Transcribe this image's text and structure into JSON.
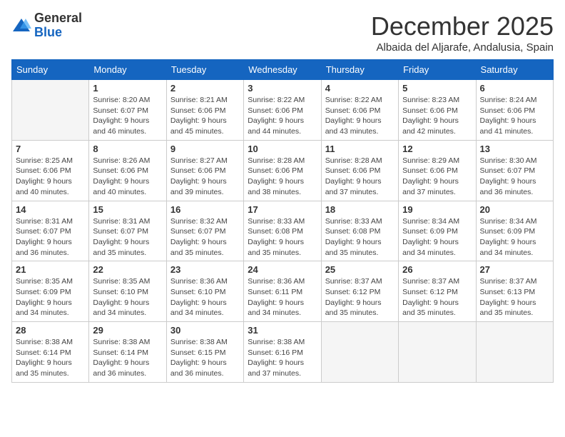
{
  "logo": {
    "general": "General",
    "blue": "Blue"
  },
  "title": "December 2025",
  "subtitle": "Albaida del Aljarafe, Andalusia, Spain",
  "days_of_week": [
    "Sunday",
    "Monday",
    "Tuesday",
    "Wednesday",
    "Thursday",
    "Friday",
    "Saturday"
  ],
  "weeks": [
    [
      {
        "day": "",
        "sunrise": "",
        "sunset": "",
        "daylight": "",
        "empty": true
      },
      {
        "day": "1",
        "sunrise": "Sunrise: 8:20 AM",
        "sunset": "Sunset: 6:07 PM",
        "daylight": "Daylight: 9 hours and 46 minutes."
      },
      {
        "day": "2",
        "sunrise": "Sunrise: 8:21 AM",
        "sunset": "Sunset: 6:06 PM",
        "daylight": "Daylight: 9 hours and 45 minutes."
      },
      {
        "day": "3",
        "sunrise": "Sunrise: 8:22 AM",
        "sunset": "Sunset: 6:06 PM",
        "daylight": "Daylight: 9 hours and 44 minutes."
      },
      {
        "day": "4",
        "sunrise": "Sunrise: 8:22 AM",
        "sunset": "Sunset: 6:06 PM",
        "daylight": "Daylight: 9 hours and 43 minutes."
      },
      {
        "day": "5",
        "sunrise": "Sunrise: 8:23 AM",
        "sunset": "Sunset: 6:06 PM",
        "daylight": "Daylight: 9 hours and 42 minutes."
      },
      {
        "day": "6",
        "sunrise": "Sunrise: 8:24 AM",
        "sunset": "Sunset: 6:06 PM",
        "daylight": "Daylight: 9 hours and 41 minutes."
      }
    ],
    [
      {
        "day": "7",
        "sunrise": "Sunrise: 8:25 AM",
        "sunset": "Sunset: 6:06 PM",
        "daylight": "Daylight: 9 hours and 40 minutes."
      },
      {
        "day": "8",
        "sunrise": "Sunrise: 8:26 AM",
        "sunset": "Sunset: 6:06 PM",
        "daylight": "Daylight: 9 hours and 40 minutes."
      },
      {
        "day": "9",
        "sunrise": "Sunrise: 8:27 AM",
        "sunset": "Sunset: 6:06 PM",
        "daylight": "Daylight: 9 hours and 39 minutes."
      },
      {
        "day": "10",
        "sunrise": "Sunrise: 8:28 AM",
        "sunset": "Sunset: 6:06 PM",
        "daylight": "Daylight: 9 hours and 38 minutes."
      },
      {
        "day": "11",
        "sunrise": "Sunrise: 8:28 AM",
        "sunset": "Sunset: 6:06 PM",
        "daylight": "Daylight: 9 hours and 37 minutes."
      },
      {
        "day": "12",
        "sunrise": "Sunrise: 8:29 AM",
        "sunset": "Sunset: 6:06 PM",
        "daylight": "Daylight: 9 hours and 37 minutes."
      },
      {
        "day": "13",
        "sunrise": "Sunrise: 8:30 AM",
        "sunset": "Sunset: 6:07 PM",
        "daylight": "Daylight: 9 hours and 36 minutes."
      }
    ],
    [
      {
        "day": "14",
        "sunrise": "Sunrise: 8:31 AM",
        "sunset": "Sunset: 6:07 PM",
        "daylight": "Daylight: 9 hours and 36 minutes."
      },
      {
        "day": "15",
        "sunrise": "Sunrise: 8:31 AM",
        "sunset": "Sunset: 6:07 PM",
        "daylight": "Daylight: 9 hours and 35 minutes."
      },
      {
        "day": "16",
        "sunrise": "Sunrise: 8:32 AM",
        "sunset": "Sunset: 6:07 PM",
        "daylight": "Daylight: 9 hours and 35 minutes."
      },
      {
        "day": "17",
        "sunrise": "Sunrise: 8:33 AM",
        "sunset": "Sunset: 6:08 PM",
        "daylight": "Daylight: 9 hours and 35 minutes."
      },
      {
        "day": "18",
        "sunrise": "Sunrise: 8:33 AM",
        "sunset": "Sunset: 6:08 PM",
        "daylight": "Daylight: 9 hours and 35 minutes."
      },
      {
        "day": "19",
        "sunrise": "Sunrise: 8:34 AM",
        "sunset": "Sunset: 6:09 PM",
        "daylight": "Daylight: 9 hours and 34 minutes."
      },
      {
        "day": "20",
        "sunrise": "Sunrise: 8:34 AM",
        "sunset": "Sunset: 6:09 PM",
        "daylight": "Daylight: 9 hours and 34 minutes."
      }
    ],
    [
      {
        "day": "21",
        "sunrise": "Sunrise: 8:35 AM",
        "sunset": "Sunset: 6:09 PM",
        "daylight": "Daylight: 9 hours and 34 minutes."
      },
      {
        "day": "22",
        "sunrise": "Sunrise: 8:35 AM",
        "sunset": "Sunset: 6:10 PM",
        "daylight": "Daylight: 9 hours and 34 minutes."
      },
      {
        "day": "23",
        "sunrise": "Sunrise: 8:36 AM",
        "sunset": "Sunset: 6:10 PM",
        "daylight": "Daylight: 9 hours and 34 minutes."
      },
      {
        "day": "24",
        "sunrise": "Sunrise: 8:36 AM",
        "sunset": "Sunset: 6:11 PM",
        "daylight": "Daylight: 9 hours and 34 minutes."
      },
      {
        "day": "25",
        "sunrise": "Sunrise: 8:37 AM",
        "sunset": "Sunset: 6:12 PM",
        "daylight": "Daylight: 9 hours and 35 minutes."
      },
      {
        "day": "26",
        "sunrise": "Sunrise: 8:37 AM",
        "sunset": "Sunset: 6:12 PM",
        "daylight": "Daylight: 9 hours and 35 minutes."
      },
      {
        "day": "27",
        "sunrise": "Sunrise: 8:37 AM",
        "sunset": "Sunset: 6:13 PM",
        "daylight": "Daylight: 9 hours and 35 minutes."
      }
    ],
    [
      {
        "day": "28",
        "sunrise": "Sunrise: 8:38 AM",
        "sunset": "Sunset: 6:14 PM",
        "daylight": "Daylight: 9 hours and 35 minutes."
      },
      {
        "day": "29",
        "sunrise": "Sunrise: 8:38 AM",
        "sunset": "Sunset: 6:14 PM",
        "daylight": "Daylight: 9 hours and 36 minutes."
      },
      {
        "day": "30",
        "sunrise": "Sunrise: 8:38 AM",
        "sunset": "Sunset: 6:15 PM",
        "daylight": "Daylight: 9 hours and 36 minutes."
      },
      {
        "day": "31",
        "sunrise": "Sunrise: 8:38 AM",
        "sunset": "Sunset: 6:16 PM",
        "daylight": "Daylight: 9 hours and 37 minutes."
      },
      {
        "day": "",
        "sunrise": "",
        "sunset": "",
        "daylight": "",
        "empty": true
      },
      {
        "day": "",
        "sunrise": "",
        "sunset": "",
        "daylight": "",
        "empty": true
      },
      {
        "day": "",
        "sunrise": "",
        "sunset": "",
        "daylight": "",
        "empty": true
      }
    ]
  ]
}
